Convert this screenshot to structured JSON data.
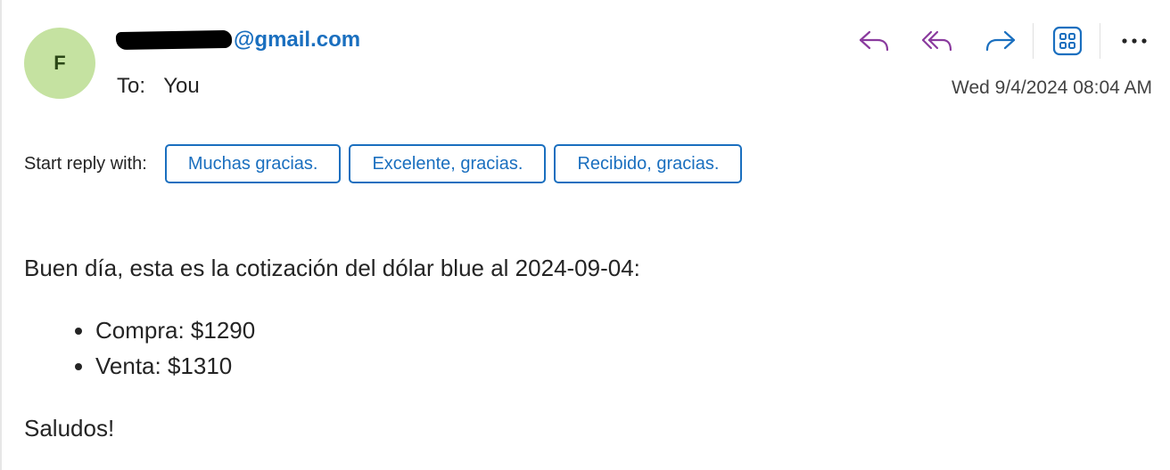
{
  "header": {
    "avatar_initial": "F",
    "sender_visible": "@gmail.com",
    "to_label": "To:",
    "to_value": "You",
    "date": "Wed 9/4/2024 08:04 AM"
  },
  "toolbar": {
    "icons": [
      "reply-icon",
      "reply-all-icon",
      "forward-icon",
      "apps-icon",
      "more-icon"
    ],
    "reply_color": "#8a3a9e",
    "forward_color": "#1a6fbf"
  },
  "quick_reply": {
    "label": "Start reply with:",
    "options": [
      "Muchas gracias.",
      "Excelente, gracias.",
      "Recibido, gracias."
    ]
  },
  "message": {
    "intro": "Buen día, esta es la cotización del dólar blue al 2024-09-04:",
    "items": [
      "Compra: $1290",
      "Venta: $1310"
    ],
    "closing": "Saludos!"
  },
  "colors": {
    "accent": "#1a6fbf",
    "avatar_bg": "#c5e2a1",
    "avatar_text": "#2b4716"
  }
}
